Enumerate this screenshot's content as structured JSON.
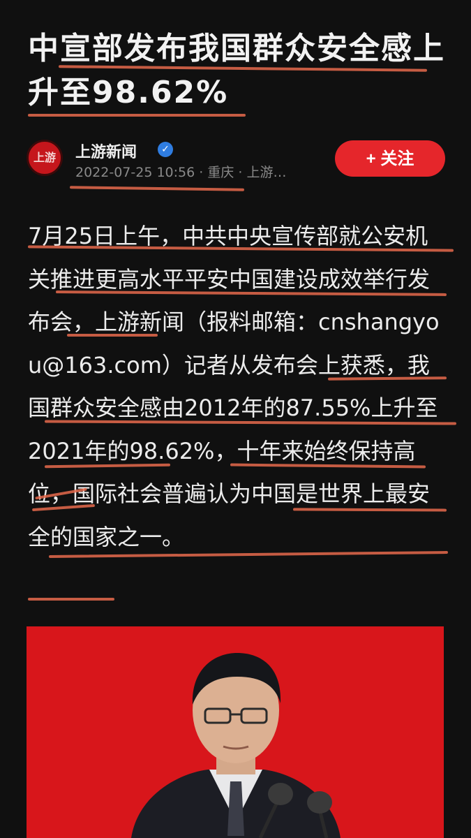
{
  "article": {
    "title": "中宣部发布我国群众安全感上升至98.62%",
    "author": "上游新闻",
    "avatar_text": "上游",
    "verified_icon": "verified-check-icon",
    "meta": "2022-07-25 10:56 · 重庆 · 上游…",
    "follow_label": "+ 关注",
    "body": "7月25日上午，中共中央宣传部就公安机关推进更高水平平安中国建设成效举行发布会，上游新闻（报料邮箱：cnshangyou@163.com）记者从发布会上获悉，我国群众安全感由2012年的87.55%上升至2021年的98.62%，十年来始终保持高位，国际社会普遍认为中国是世界上最安全的国家之一。"
  },
  "colors": {
    "background": "#101010",
    "accent_red": "#e5262b",
    "underline": "#e66a4c",
    "photo_background": "#d8161b"
  }
}
